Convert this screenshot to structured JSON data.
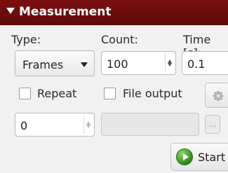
{
  "panel": {
    "title": "Measurement",
    "type_label": "Type:",
    "count_label": "Count:",
    "time_label": "Time [s]:",
    "type_value": "Frames",
    "count_value": "100",
    "time_value": "0.1",
    "repeat_label": "Repeat",
    "file_output_label": "File output",
    "repeat_count_value": "0",
    "file_path_value": "",
    "browse_label": "...",
    "start_label": "Start"
  },
  "colors": {
    "header": "#6b0d0d",
    "start_icon": "#3e9a22"
  },
  "icons": {
    "collapse": "triangle-down-icon",
    "settings": "gear-icon",
    "start": "play-icon"
  }
}
